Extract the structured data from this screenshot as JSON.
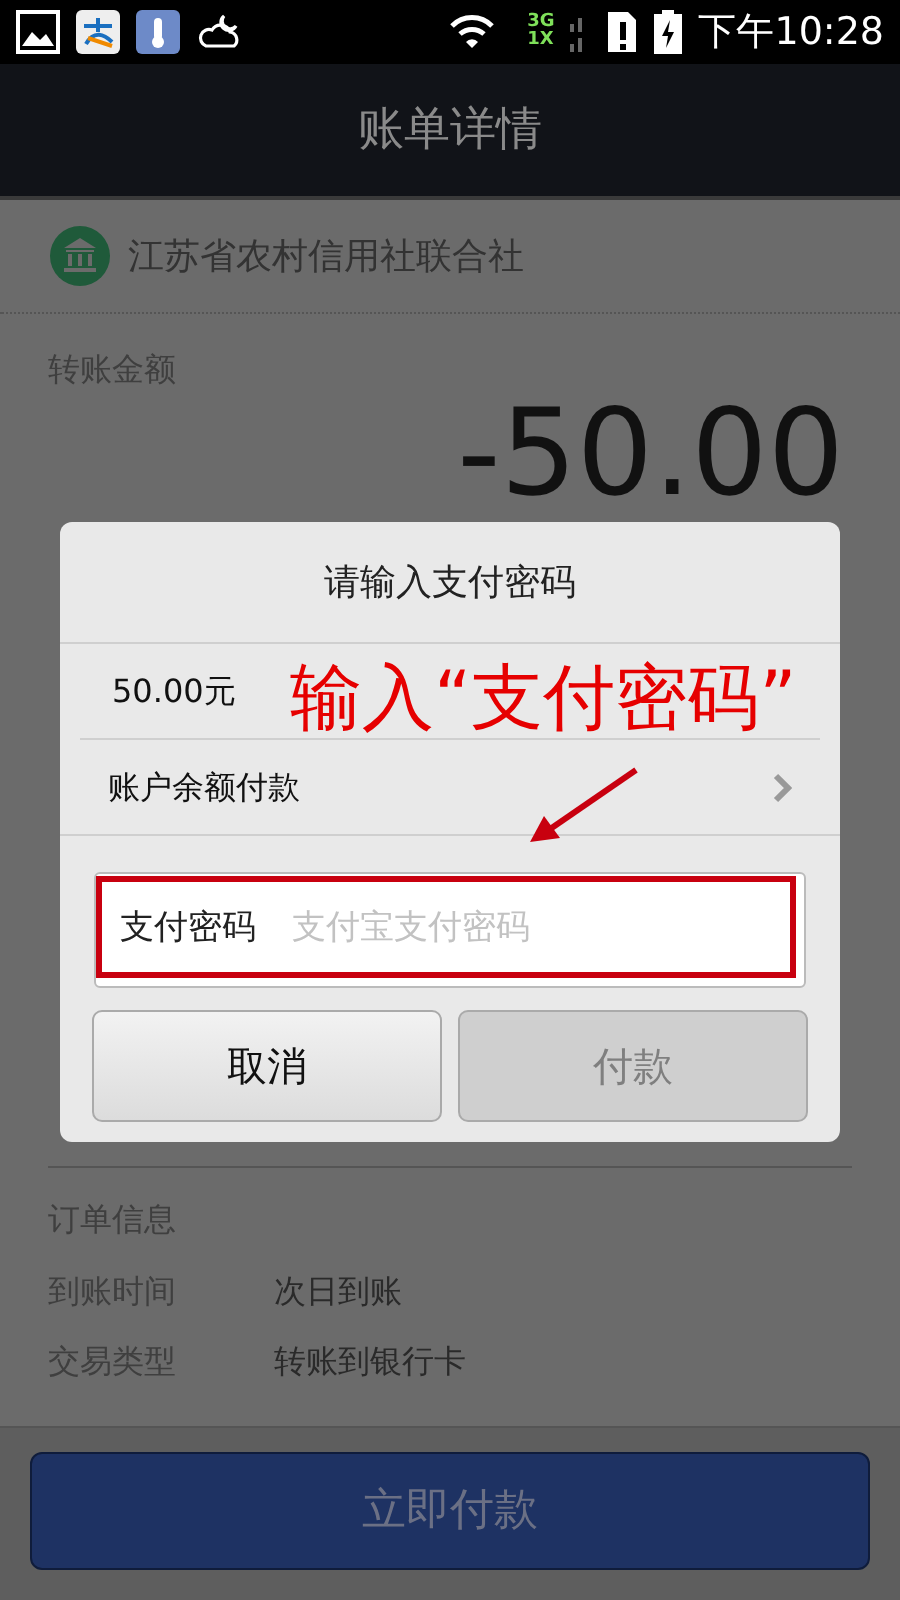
{
  "status_bar": {
    "network": "3G",
    "network_2": "1X",
    "time": "下午10:28"
  },
  "app_bar": {
    "title": "账单详情"
  },
  "bill": {
    "bank": "江苏省农村信用社联合社",
    "amount_label": "转账金额",
    "amount": "-50.00",
    "section_title": "订单信息",
    "rows": [
      {
        "label": "到账时间",
        "value": "次日到账"
      },
      {
        "label": "交易类型",
        "value": "转账到银行卡"
      }
    ]
  },
  "dialog": {
    "title": "请输入支付密码",
    "amount": "50.00元",
    "payment_method": "账户余额付款",
    "password_field": {
      "label": "支付密码",
      "placeholder": "支付宝支付密码"
    },
    "buttons": [
      {
        "label": "取消",
        "disabled": false
      },
      {
        "label": "付款",
        "disabled": true
      }
    ]
  },
  "annotation": {
    "text": "输入“支付密码”"
  },
  "pay_button": {
    "label": "立即付款"
  }
}
